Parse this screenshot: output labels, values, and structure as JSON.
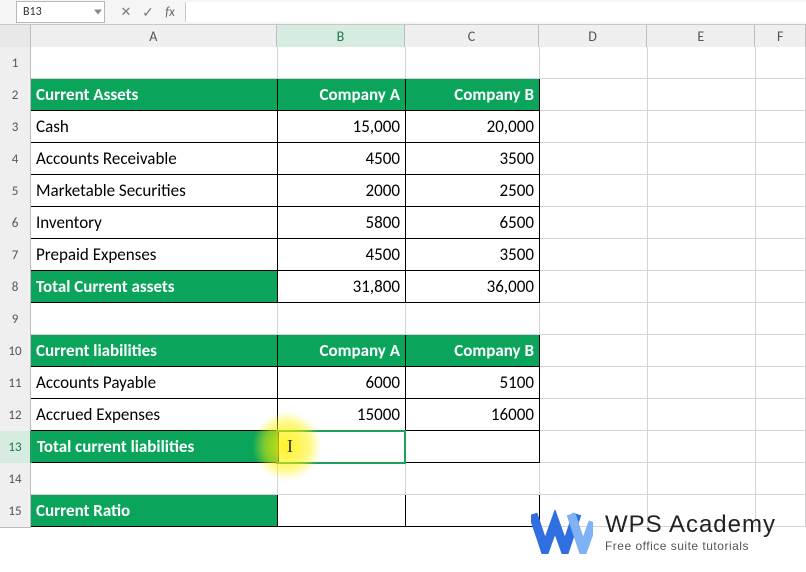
{
  "editor": {
    "name_box": "B13",
    "formula": ""
  },
  "columns": [
    "A",
    "B",
    "C",
    "D",
    "E",
    "F"
  ],
  "active_col": "B",
  "active_row": "13",
  "rows": [
    {
      "num": "1",
      "cells": [
        "",
        "",
        "",
        "",
        "",
        ""
      ]
    },
    {
      "num": "2",
      "cells": [
        "Current Assets",
        "Company A",
        "Company B",
        "",
        "",
        ""
      ],
      "style": [
        "hdr",
        "hdr num",
        "hdr num",
        "",
        "",
        ""
      ]
    },
    {
      "num": "3",
      "cells": [
        "Cash",
        "15,000",
        "20,000",
        "",
        "",
        ""
      ],
      "style": [
        "bordered",
        "bordered num",
        "bordered num",
        "",
        "",
        ""
      ]
    },
    {
      "num": "4",
      "cells": [
        "Accounts Receivable",
        "4500",
        "3500",
        "",
        "",
        ""
      ],
      "style": [
        "bordered",
        "bordered num",
        "bordered num",
        "",
        "",
        ""
      ]
    },
    {
      "num": "5",
      "cells": [
        "Marketable Securities",
        "2000",
        "2500",
        "",
        "",
        ""
      ],
      "style": [
        "bordered",
        "bordered num",
        "bordered num",
        "",
        "",
        ""
      ]
    },
    {
      "num": "6",
      "cells": [
        "Inventory",
        "5800",
        "6500",
        "",
        "",
        ""
      ],
      "style": [
        "bordered",
        "bordered num",
        "bordered num",
        "",
        "",
        ""
      ]
    },
    {
      "num": "7",
      "cells": [
        "Prepaid Expenses",
        "4500",
        "3500",
        "",
        "",
        ""
      ],
      "style": [
        "bordered",
        "bordered num",
        "bordered num",
        "",
        "",
        ""
      ]
    },
    {
      "num": "8",
      "cells": [
        "Total Current assets",
        "31,800",
        "36,000",
        "",
        "",
        ""
      ],
      "style": [
        "hdr",
        "bordered num",
        "bordered num",
        "",
        "",
        ""
      ]
    },
    {
      "num": "9",
      "cells": [
        "",
        "",
        "",
        "",
        "",
        ""
      ]
    },
    {
      "num": "10",
      "cells": [
        "Current liabilities",
        "Company A",
        "Company B",
        "",
        "",
        ""
      ],
      "style": [
        "hdr",
        "hdr num",
        "hdr num",
        "",
        "",
        ""
      ]
    },
    {
      "num": "11",
      "cells": [
        "Accounts Payable",
        "6000",
        "5100",
        "",
        "",
        ""
      ],
      "style": [
        "bordered",
        "bordered num",
        "bordered num",
        "",
        "",
        ""
      ]
    },
    {
      "num": "12",
      "cells": [
        "Accrued Expenses",
        "15000",
        "16000",
        "",
        "",
        ""
      ],
      "style": [
        "bordered",
        "bordered num",
        "bordered num",
        "",
        "",
        ""
      ]
    },
    {
      "num": "13",
      "cells": [
        "Total current liabilities",
        "",
        "",
        "",
        "",
        ""
      ],
      "style": [
        "hdr",
        "bordered",
        "bordered",
        "",
        "",
        ""
      ]
    },
    {
      "num": "14",
      "cells": [
        "",
        "",
        "",
        "",
        "",
        ""
      ]
    },
    {
      "num": "15",
      "cells": [
        "Current Ratio",
        "",
        "",
        "",
        "",
        ""
      ],
      "style": [
        "hdr",
        "bordered",
        "bordered",
        "",
        "",
        ""
      ]
    }
  ],
  "watermark": {
    "title": "WPS Academy",
    "subtitle": "Free office suite tutorials"
  },
  "colors": {
    "header_bg": "#0aa55a",
    "active_border": "#1f9e5c",
    "highlight": "#fff100"
  }
}
